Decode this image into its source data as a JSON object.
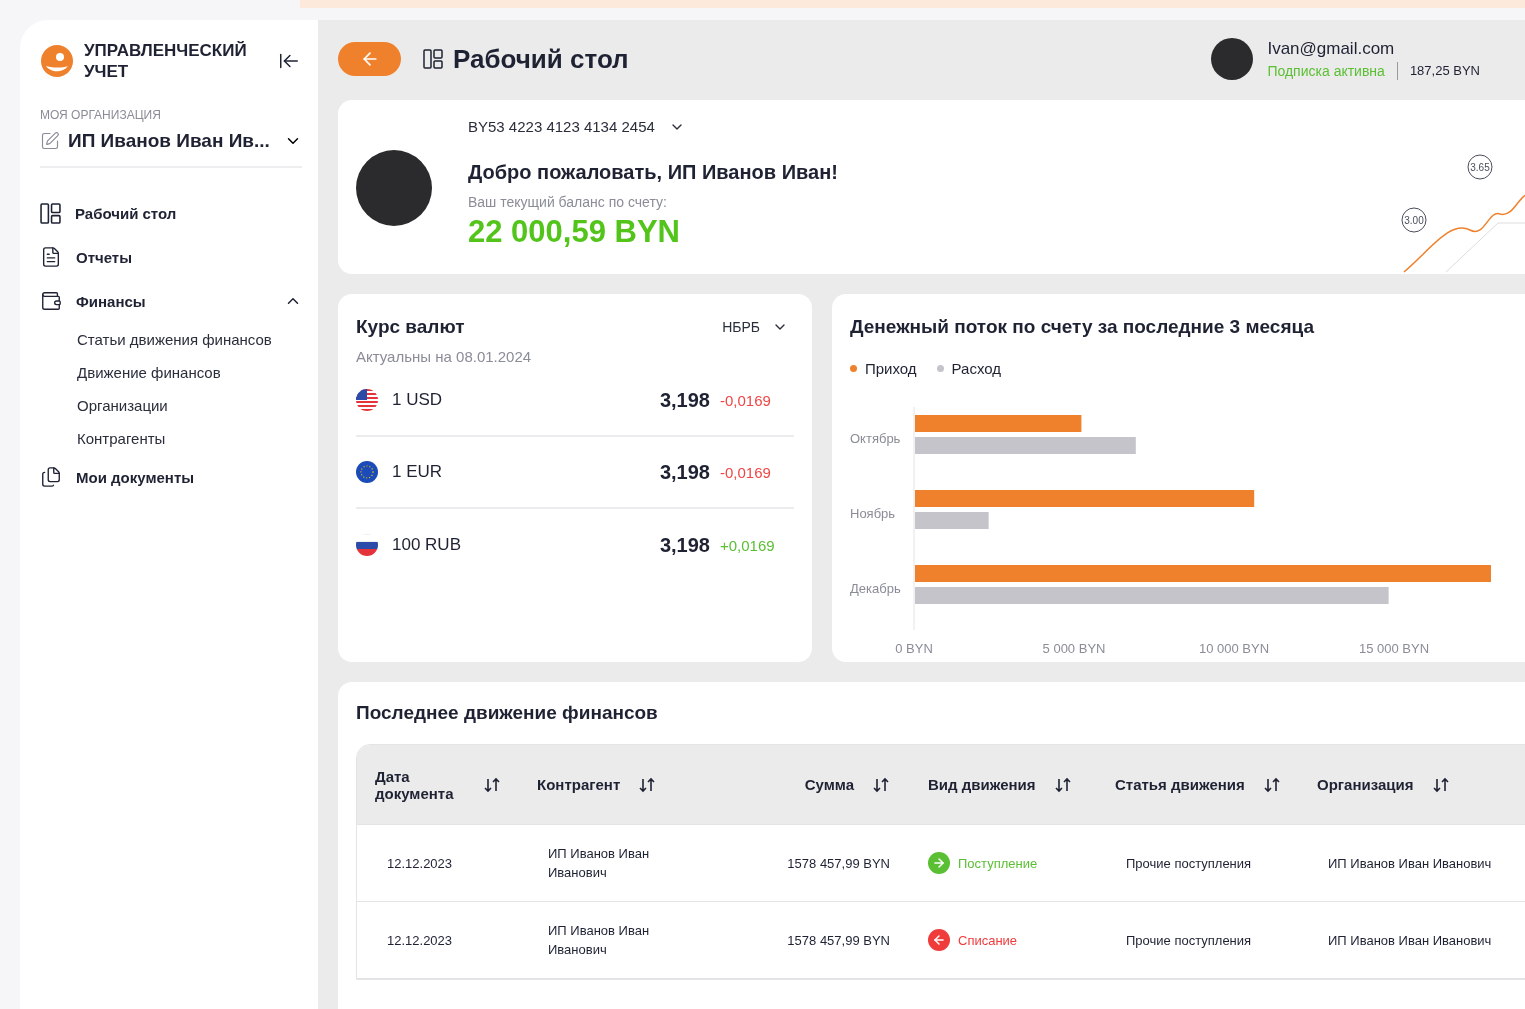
{
  "sidebar": {
    "logo_text": "УПРАВЛЕНЧЕСКИЙ УЧЕТ",
    "org_label": "МОЯ ОРГАНИЗАЦИЯ",
    "org_name": "ИП Иванов Иван Ив...",
    "items": [
      {
        "label": "Рабочий стол"
      },
      {
        "label": "Отчеты"
      },
      {
        "label": "Финансы",
        "expanded": true,
        "children": [
          {
            "label": "Статьи движения финансов"
          },
          {
            "label": "Движение финансов"
          },
          {
            "label": "Организации"
          },
          {
            "label": "Контрагенты"
          }
        ]
      },
      {
        "label": "Мои документы"
      }
    ]
  },
  "header": {
    "title": "Рабочий стол",
    "email": "Ivan@gmail.com",
    "subscription": "Подписка активна",
    "balance": "187,25 BYN"
  },
  "welcome": {
    "account": "BY53 4223 4123 4134 2454",
    "title": "Добро пожаловать, ИП Иванов Иван!",
    "balance_label": "Ваш текущий баланс по счету:",
    "balance": "22 000,59 BYN",
    "sparkline_labels": [
      "3.00",
      "3.65"
    ]
  },
  "rates": {
    "title": "Курс валют",
    "source": "НБРБ",
    "date": "Актуальны на 08.01.2024",
    "items": [
      {
        "kind": "us",
        "code": "1 USD",
        "rate": "3,198",
        "change": "-0,0169",
        "color": "#f04646"
      },
      {
        "kind": "eu",
        "code": "1 EUR",
        "rate": "3,198",
        "change": "-0,0169",
        "color": "#f04646"
      },
      {
        "kind": "ru",
        "code": "100 RUB",
        "rate": "3,198",
        "change": "+0,0169",
        "color": "#5bbf33"
      }
    ]
  },
  "cashflow": {
    "title": "Денежный поток по счету за последние 3 месяца",
    "chart_data": {
      "type": "bar",
      "orientation": "horizontal",
      "categories": [
        "Октябрь",
        "Ноябрь",
        "Декабрь"
      ],
      "series": [
        {
          "name": "Приход",
          "color": "#f0812c",
          "values": [
            5200,
            10600,
            18000
          ]
        },
        {
          "name": "Расход",
          "color": "#c4c4ca",
          "values": [
            6900,
            2300,
            14800
          ]
        }
      ],
      "stacked": false,
      "xlim": [
        0,
        18000
      ],
      "xticks": [
        {
          "value": 0,
          "label": "0 BYN"
        },
        {
          "value": 5000,
          "label": "5 000 BYN"
        },
        {
          "value": 10000,
          "label": "10 000 BYN"
        },
        {
          "value": 15000,
          "label": "15 000 BYN"
        }
      ]
    }
  },
  "movements": {
    "title": "Последнее движение финансов",
    "columns": [
      "Дата документа",
      "Контрагент",
      "Сумма",
      "Вид движения",
      "Статья движения",
      "Организация"
    ],
    "rows": [
      {
        "date": "12.12.2023",
        "counterparty": "ИП Иванов Иван Иванович",
        "amount": "1578 457,99 BYN",
        "kind": "income",
        "type": "Поступление",
        "article": "Прочие поступления",
        "org": "ИП Иванов Иван Иванович"
      },
      {
        "date": "12.12.2023",
        "counterparty": "ИП Иванов Иван Иванович",
        "amount": "1578 457,99 BYN",
        "kind": "expense",
        "type": "Списание",
        "article": "Прочие поступления",
        "org": "ИП Иванов Иван Иванович"
      }
    ]
  }
}
